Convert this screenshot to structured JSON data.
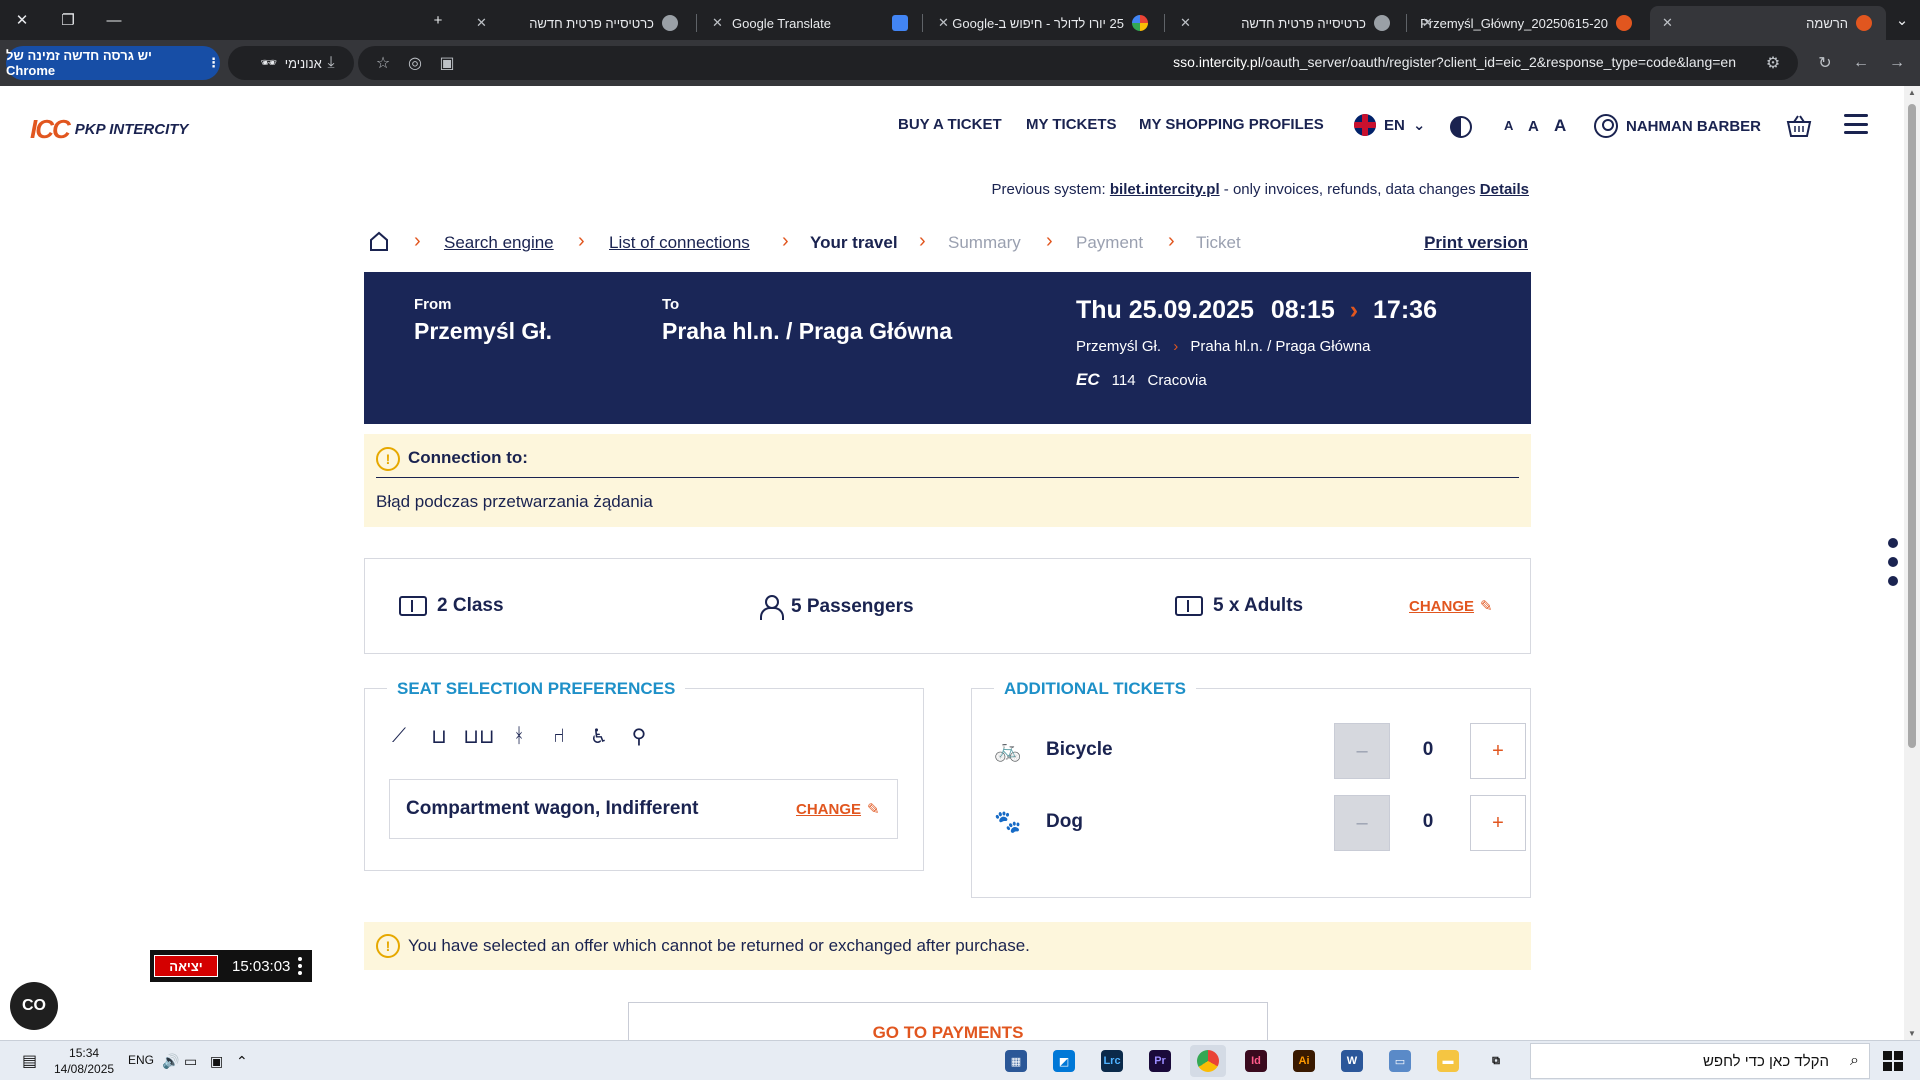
{
  "browser": {
    "tabs": [
      {
        "title": "הרשמה",
        "active": true
      },
      {
        "title": "Przemyśl_Główny_20250615-20",
        "active": false
      },
      {
        "title": "כרטיסייה פרטית חדשה",
        "active": false
      },
      {
        "title": "25 יורו לדולר - חיפוש ב-Google",
        "active": false
      },
      {
        "title": "Google Translate",
        "active": false
      },
      {
        "title": "כרטיסייה פרטית חדשה",
        "active": false
      }
    ],
    "url_domain": "sso.intercity.pl",
    "url_path": "/oauth_server/oauth/register?client_id=eic_2&response_type=code&lang=en",
    "incognito_label": "אנונימי",
    "new_version_label": "יש גרסה חדשה זמינה של Chrome"
  },
  "header": {
    "logo_mark": "ICC",
    "logo_name": "PKP INTERCITY",
    "nav": [
      "BUY A TICKET",
      "MY TICKETS",
      "MY SHOPPING PROFILES"
    ],
    "language": "EN",
    "font_sizes": [
      "A",
      "A",
      "A"
    ],
    "user_name": "NAHMAN BARBER"
  },
  "notice": {
    "prefix": "Previous system:",
    "link": "bilet.intercity.pl",
    "suffix": "- only invoices, refunds, data changes",
    "details": "Details"
  },
  "breadcrumb": {
    "items": [
      "Search engine",
      "List of connections",
      "Your travel",
      "Summary",
      "Payment",
      "Ticket"
    ],
    "print": "Print version"
  },
  "journey": {
    "from_label": "From",
    "from": "Przemyśl Gł.",
    "to_label": "To",
    "to": "Praha hl.n. / Praga Główna",
    "date": "Thu 25.09.2025",
    "depart": "08:15",
    "arrive": "17:36",
    "route_from": "Przemyśl Gł.",
    "route_to": "Praha hl.n. / Praga Główna",
    "train_type": "EC",
    "train_no": "114",
    "train_name": "Cracovia"
  },
  "warning1": {
    "icon": "!",
    "title": "Connection to:",
    "message": "Błąd podczas przetwarzania żądania"
  },
  "summary": {
    "class": "2 Class",
    "passengers": "5 Passengers",
    "tickets": "5 x Adults",
    "change": "CHANGE"
  },
  "seat": {
    "legend": "SEAT SELECTION PREFERENCES",
    "icons": [
      "recliner-seat-icon",
      "compartment-seat-icon",
      "double-seat-icon",
      "window-seat-icon",
      "table-seat-icon",
      "wheelchair-icon",
      "bicycle-space-icon"
    ],
    "preference": "Compartment wagon, Indifferent",
    "change": "CHANGE"
  },
  "additional": {
    "legend": "ADDITIONAL TICKETS",
    "items": [
      {
        "label": "Bicycle",
        "value": "0",
        "icon": "bicycle-icon"
      },
      {
        "label": "Dog",
        "value": "0",
        "icon": "paw-icon"
      }
    ],
    "minus": "–",
    "plus": "+"
  },
  "warning2": {
    "icon": "!",
    "message": "You have selected an offer which cannot be returned or exchanged after purchase."
  },
  "go_to_payments": "GO TO PAYMENTS",
  "overlay": {
    "exit": "יציאה",
    "timer": "15:03:03",
    "float_label": "CO"
  },
  "taskbar": {
    "time": "15:34",
    "date": "14/08/2025",
    "lang": "ENG",
    "search_placeholder": "הקלד כאן כדי לחפש",
    "apps": [
      "Lrc",
      "Pr",
      "Id",
      "Ai"
    ]
  },
  "colors": {
    "navy": "#1a2657",
    "accent": "#e1561f",
    "legend_blue": "#1e90c8",
    "warning_bg": "#fdf6dc"
  }
}
